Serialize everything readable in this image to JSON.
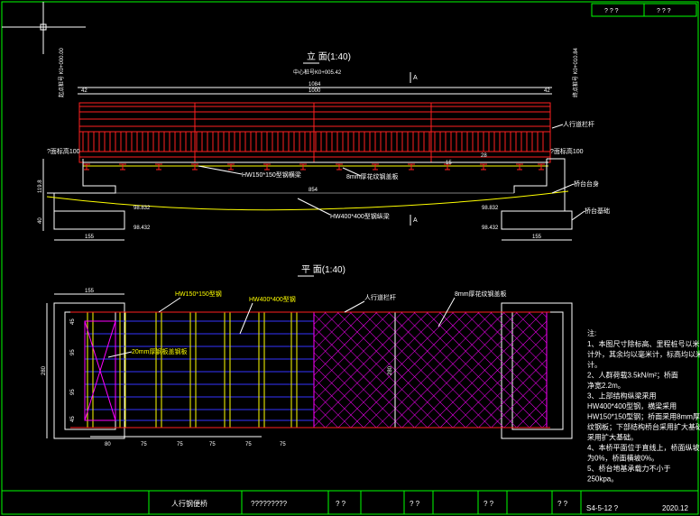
{
  "elevation": {
    "title": "立    面(1:40)",
    "center_station": "中心桩号K0+005.42",
    "left_end_label": "起点桩号 K0+000.00",
    "right_end_label": "终点桩号 K0+010.84",
    "total_length": "1084",
    "span_length": "1000",
    "left_deck_elev": "?面标高100",
    "right_deck_elev": "?面标高100",
    "railing_label": "人行道栏杆",
    "hw150_label": "HW150*150型钢横梁",
    "plate_label": "8mm厚花纹钢盖板",
    "hw400_label": "HW400*400型钢纵梁",
    "abutment_label": "桥台台身",
    "foundation_label": "桥台基础",
    "clear_span": "854",
    "left_height": "119.8",
    "left_foot_height": "40",
    "left_elev_top": "98.832",
    "left_elev_bottom": "98.432",
    "right_elev_top": "98.832",
    "right_elev_bottom": "98.432",
    "left_width": "155",
    "right_width": "155",
    "mid_height": "28",
    "edge_dims": [
      "42",
      "42",
      "15"
    ],
    "section_a_top": "A",
    "section_a_bottom": "A"
  },
  "plan": {
    "title": "平    面(1:40)",
    "hw150_label": "HW150*150型钢",
    "hw400_label": "HW400*400型钢",
    "railing_label": "人行道栏杆",
    "plate_label": "8mm厚花纹钢盖板",
    "thick_plate_label": "20mm厚钢板盖钢板",
    "width_top": "155",
    "total_width": "280",
    "inner_width": "280",
    "side_dims": [
      "45",
      "95",
      "95",
      "45"
    ],
    "bottom_dims": [
      "80",
      "75",
      "75",
      "75",
      "75",
      "75"
    ]
  },
  "notes": {
    "heading": "注:",
    "lines": [
      "1、本图尺寸除标高、里程桩号以米",
      "计外，其余均以毫米计，标高均以米",
      "计。",
      "2、人群荷载3.5kN/m²；桥面",
      "净宽2.2m。",
      "3、上部结构纵梁采用",
      "HW400*400型钢，横梁采用",
      "HW150*150型钢；桥面采用8mm厚花",
      "纹钢板；下部结构桥台采用扩大基础，基础",
      "采用扩大基础。",
      "4、本桥平面位于直线上，桥面纵坡",
      "为0%，桥面横坡0%。",
      "5、桥台地基承载力不小于",
      "250kpa。"
    ]
  },
  "title_block": {
    "top_right_cells": [
      "? ? ?",
      "? ? ?"
    ],
    "drawing_name": "人行钢便桥",
    "project_name": "?????????",
    "cells": [
      "? ?",
      "? ?",
      "? ?",
      "? ?"
    ],
    "sheet_number": "S4-5-12 ?",
    "date": "2020.12"
  }
}
